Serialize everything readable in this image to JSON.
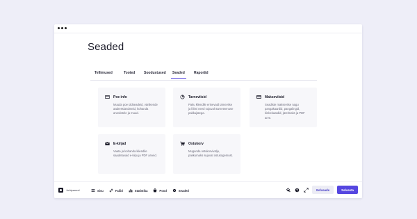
{
  "page": {
    "title": "Seaded"
  },
  "tabs": [
    {
      "label": "Tellimused"
    },
    {
      "label": "Tooted"
    },
    {
      "label": "Soodustused"
    },
    {
      "label": "Seaded",
      "active": true
    },
    {
      "label": "Raportid"
    }
  ],
  "cards": [
    {
      "icon": "store-icon",
      "title": "Poe info",
      "description": "Muuda poe üldseadeid, vänikende aadressiandmeid, kohanda arvedetele ja muud."
    },
    {
      "icon": "delivery-icon",
      "title": "Tarneviisid",
      "description": "Paku kliendile erinevaid tarneviise ja lõimi need sujuvalt tarneteenuse pakkujatega."
    },
    {
      "icon": "credit-card-icon",
      "title": "Makseviisid",
      "description": "Seadiste makseviise nagu pangakaardid, pangalingid, kinkekaardid, järelmaks ja PDF arve."
    },
    {
      "icon": "mail-icon",
      "title": "E-kirjad",
      "description": "Vaata ja kohanda kliendile saadetavaid e-kirju ja PDF arveid."
    },
    {
      "icon": "cart-icon",
      "title": "Ostukorv",
      "description": "Muganda ostukorvivälju, pakkumaks sujuvat ostukogemust."
    }
  ],
  "bottombar": {
    "brand": "Juhtpaneel",
    "nav": [
      {
        "icon": "menu-icon",
        "label": "Sisu"
      },
      {
        "icon": "link-icon",
        "label": "Failid"
      },
      {
        "icon": "chart-icon",
        "label": "Statistika"
      },
      {
        "icon": "shop-icon",
        "label": "Pood"
      },
      {
        "icon": "gear-icon",
        "label": "Seaded"
      }
    ],
    "preview_label": "Eelvaade",
    "save_label": "Salvesta"
  },
  "colors": {
    "accent": "#5546e0",
    "background": "#eeeef8"
  }
}
